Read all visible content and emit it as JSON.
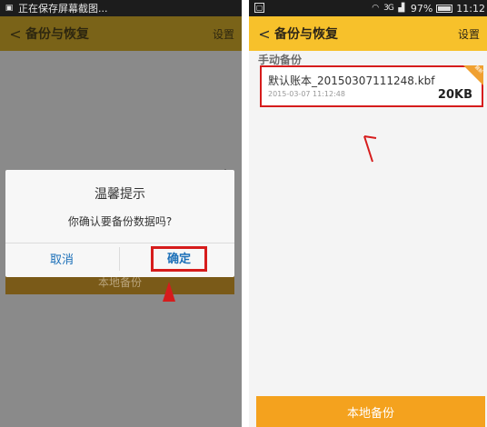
{
  "left": {
    "status_text": "正在保存屏幕截图...",
    "title": "备份与恢复",
    "settings": "设置",
    "bg_button": "本地备份",
    "dialog": {
      "title": "温馨提示",
      "message": "你确认要备份数据吗?",
      "cancel": "取消",
      "confirm": "确定"
    }
  },
  "right": {
    "status": {
      "signal": "3G",
      "battery": "97%",
      "time": "11:12"
    },
    "title": "备份与恢复",
    "settings": "设置",
    "section": "手动备份",
    "file": {
      "name": "默认账本_20150307111248.kbf",
      "time": "2015-03-07 11:12:48",
      "size": "20KB",
      "badge": "最新"
    },
    "button": "本地备份"
  },
  "colors": {
    "accent_yellow": "#f7c12b",
    "accent_orange": "#f4a21e",
    "highlight_red": "#d61c1c",
    "link_blue": "#1b6fb8"
  },
  "icons": [
    "back-arrow-icon",
    "wifi-icon",
    "signal-icon",
    "battery-icon",
    "image-icon"
  ]
}
